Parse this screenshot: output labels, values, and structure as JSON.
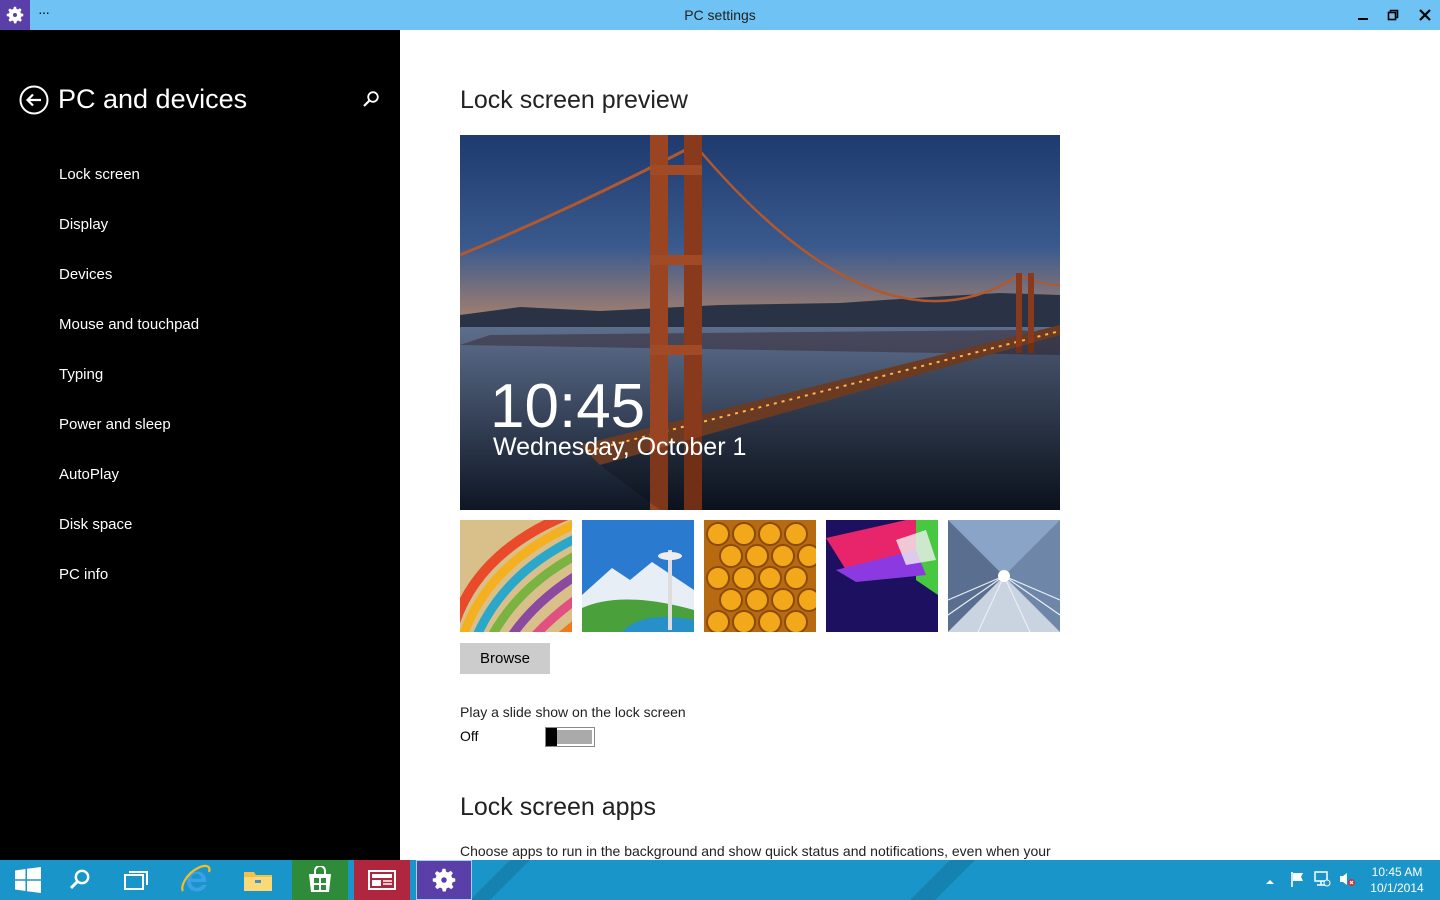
{
  "window": {
    "title": "PC settings",
    "menu_dots": "···"
  },
  "sidebar": {
    "title": "PC and devices",
    "items": [
      {
        "label": "Lock screen"
      },
      {
        "label": "Display"
      },
      {
        "label": "Devices"
      },
      {
        "label": "Mouse and touchpad"
      },
      {
        "label": "Typing"
      },
      {
        "label": "Power and sleep"
      },
      {
        "label": "AutoPlay"
      },
      {
        "label": "Disk space"
      },
      {
        "label": "PC info"
      }
    ]
  },
  "main": {
    "preview_heading": "Lock screen preview",
    "preview_time": "10:45",
    "preview_date": "Wednesday, October 1",
    "browse_label": "Browse",
    "slideshow_label": "Play a slide show on the lock screen",
    "slideshow_state": "Off",
    "apps_heading": "Lock screen apps",
    "apps_description": "Choose apps to run in the background and show quick status and notifications, even when your"
  },
  "taskbar": {
    "clock_time": "10:45 AM",
    "clock_date": "10/1/2014"
  },
  "colors": {
    "titlebar": "#6ec3f4",
    "taskbar": "#1a95c9",
    "settings_accent": "#5b3fa8"
  }
}
